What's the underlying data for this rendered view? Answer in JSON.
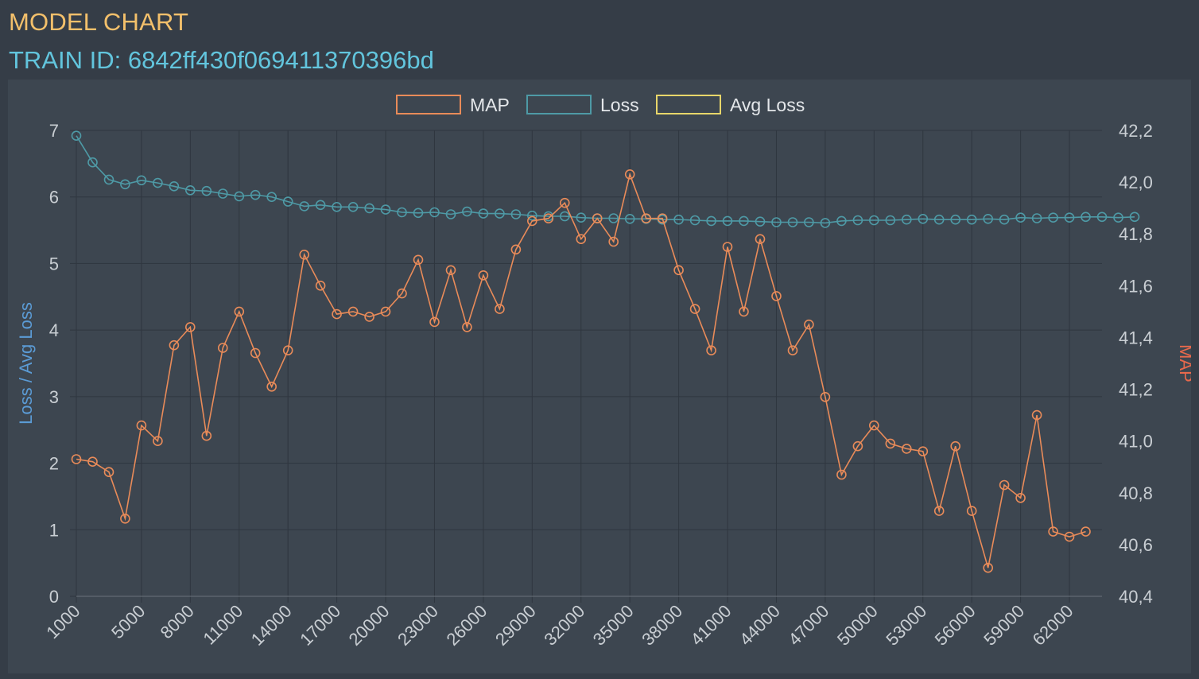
{
  "header": {
    "title": "MODEL CHART",
    "train_id": "TRAIN ID: 6842ff430f069411370396bd"
  },
  "chart_data": {
    "type": "line",
    "colors": {
      "map": "#e98b59",
      "loss": "#4e9aa6",
      "avg_loss": "#e8d66a"
    },
    "legend": [
      "MAP",
      "Loss",
      "Avg Loss"
    ],
    "left_axis": {
      "title": "Loss / Avg Loss",
      "min": 0,
      "max": 7,
      "ticks": [
        "0",
        "1",
        "2",
        "3",
        "4",
        "5",
        "6",
        "7"
      ]
    },
    "right_axis": {
      "title": "MAP",
      "min": 40.4,
      "max": 42.2,
      "ticks": [
        "40,4",
        "40,6",
        "40,8",
        "41,0",
        "41,2",
        "41,4",
        "41,6",
        "41,8",
        "42,0",
        "42,2"
      ]
    },
    "x": [
      1000,
      2000,
      3000,
      4000,
      5000,
      6000,
      7000,
      8000,
      9000,
      10000,
      11000,
      12000,
      13000,
      14000,
      15000,
      16000,
      17000,
      18000,
      19000,
      20000,
      21000,
      22000,
      23000,
      24000,
      25000,
      26000,
      27000,
      28000,
      29000,
      30000,
      31000,
      32000,
      33000,
      34000,
      35000,
      36000,
      37000,
      38000,
      39000,
      40000,
      41000,
      42000,
      43000,
      44000,
      45000,
      46000,
      47000,
      48000,
      49000,
      50000,
      51000,
      52000,
      53000,
      54000,
      55000,
      56000,
      57000,
      58000,
      59000,
      60000,
      61000,
      62000,
      63000,
      64000
    ],
    "x_tick_labels": [
      "1000",
      "5000",
      "8000",
      "11000",
      "14000",
      "17000",
      "20000",
      "23000",
      "26000",
      "29000",
      "32000",
      "35000",
      "38000",
      "41000",
      "44000",
      "47000",
      "50000",
      "53000",
      "56000",
      "59000",
      "62000"
    ],
    "series": [
      {
        "name": "MAP",
        "axis": "right",
        "values": [
          40.93,
          40.92,
          40.88,
          40.7,
          41.06,
          41.0,
          41.37,
          41.44,
          41.02,
          41.36,
          41.5,
          41.34,
          41.21,
          41.35,
          41.72,
          41.6,
          41.49,
          41.5,
          41.48,
          41.5,
          41.57,
          41.7,
          41.46,
          41.66,
          41.44,
          41.64,
          41.51,
          41.74,
          41.85,
          41.86,
          41.92,
          41.78,
          41.86,
          41.77,
          42.03,
          41.86,
          41.86,
          41.66,
          41.51,
          41.35,
          41.75,
          41.5,
          41.78,
          41.56,
          41.35,
          41.45,
          41.17,
          40.87,
          40.98,
          41.06,
          40.99,
          40.97,
          40.96,
          40.73,
          40.98,
          40.73,
          40.51,
          40.83,
          40.78,
          41.1,
          40.65,
          40.63,
          40.65
        ]
      },
      {
        "name": "Loss",
        "axis": "left",
        "values": [
          6.92,
          6.52,
          6.26,
          6.19,
          6.25,
          6.21,
          6.16,
          6.1,
          6.09,
          6.05,
          6.01,
          6.03,
          6.0,
          5.93,
          5.86,
          5.88,
          5.85,
          5.85,
          5.83,
          5.81,
          5.77,
          5.76,
          5.77,
          5.74,
          5.78,
          5.75,
          5.75,
          5.74,
          5.72,
          5.71,
          5.71,
          5.69,
          5.68,
          5.68,
          5.67,
          5.67,
          5.66,
          5.66,
          5.65,
          5.64,
          5.64,
          5.64,
          5.63,
          5.62,
          5.62,
          5.62,
          5.61,
          5.64,
          5.65,
          5.65,
          5.65,
          5.66,
          5.67,
          5.66,
          5.66,
          5.66,
          5.67,
          5.66,
          5.69,
          5.68,
          5.69,
          5.69,
          5.7,
          5.7,
          5.69,
          5.7
        ]
      },
      {
        "name": "Avg Loss",
        "axis": "left",
        "values": []
      }
    ]
  }
}
